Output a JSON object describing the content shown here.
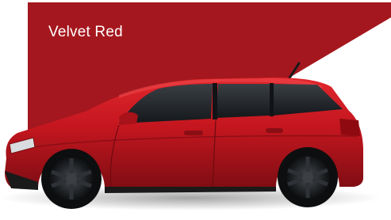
{
  "swatch": {
    "label": "Velvet Red",
    "panel_color": "#a5171e",
    "car_body_color": "#c4161f"
  },
  "image": {
    "subject": "car-side-view",
    "background_color": "#ffffff"
  }
}
